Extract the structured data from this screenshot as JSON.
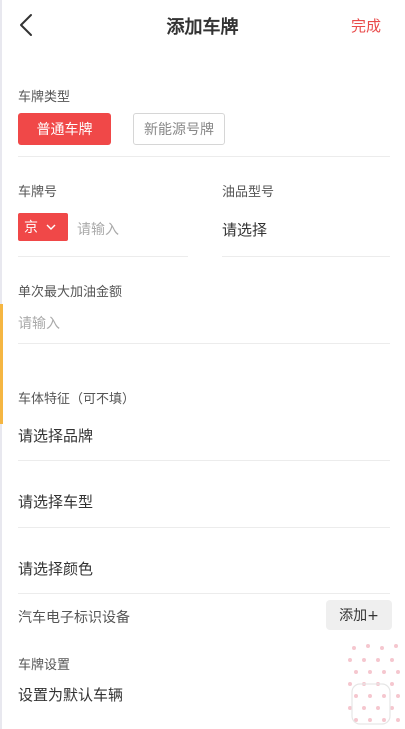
{
  "nav": {
    "title": "添加车牌",
    "done": "完成"
  },
  "plate_type": {
    "label": "车牌类型",
    "options": [
      "普通车牌",
      "新能源号牌"
    ],
    "selected": "普通车牌"
  },
  "plate_number": {
    "label": "车牌号",
    "province": "京",
    "placeholder": "请输入"
  },
  "fuel_type": {
    "label": "油品型号",
    "value": "请选择"
  },
  "max_fuel_amount": {
    "label": "单次最大加油金额",
    "placeholder": "请输入"
  },
  "vehicle_features": {
    "label": "车体特征（可不填）",
    "brand": "请选择品牌",
    "model": "请选择车型",
    "color": "请选择颜色"
  },
  "etc_device": {
    "label": "汽车电子标识设备",
    "add_label": "添加+"
  },
  "plate_settings": {
    "label": "车牌设置",
    "default_vehicle": "设置为默认车辆"
  },
  "colors": {
    "accent": "#f04848",
    "done": "#e94b4b",
    "left_accent": "#f5b642"
  }
}
